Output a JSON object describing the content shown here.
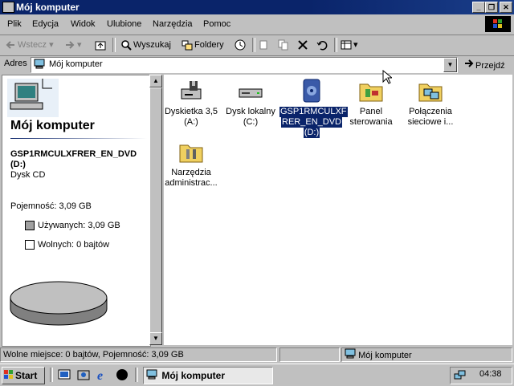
{
  "window": {
    "title": "Mój komputer"
  },
  "menu": [
    "Plik",
    "Edycja",
    "Widok",
    "Ulubione",
    "Narzędzia",
    "Pomoc"
  ],
  "toolbar": {
    "back": "Wstecz",
    "search": "Wyszukaj",
    "folders": "Foldery"
  },
  "address": {
    "label": "Adres",
    "value": "Mój komputer",
    "go": "Przejdź"
  },
  "left_pane": {
    "heading": "Mój komputer",
    "drive_name": "GSP1RMCULXFRER_EN_DVD",
    "drive_letter": "(D:)",
    "drive_type": "Dysk CD",
    "capacity": "Pojemność: 3,09 GB",
    "used": "Używanych: 3,09 GB",
    "free": "Wolnych: 0 bajtów",
    "used_color": "#a0a0a0",
    "free_color": "#ffffff"
  },
  "files": [
    {
      "label1": "Dyskietka 3,5",
      "label2": "(A:)",
      "icon": "floppy-drive-icon"
    },
    {
      "label1": "Dysk lokalny",
      "label2": "(C:)",
      "icon": "hard-drive-icon"
    },
    {
      "label1": "GSP1RMCULXF",
      "label2": "RER_EN_DVD",
      "label3": "(D:)",
      "icon": "cd-drive-icon",
      "selected": true
    },
    {
      "label1": "Panel",
      "label2": "sterowania",
      "icon": "control-panel-icon"
    },
    {
      "label1": "Połączenia",
      "label2": "sieciowe i...",
      "icon": "network-connections-icon"
    },
    {
      "label1": "Narzędzia",
      "label2": "administrac...",
      "icon": "admin-tools-icon"
    }
  ],
  "status": {
    "left": "Wolne miejsce: 0 bajtów, Pojemność: 3,09 GB",
    "right": "Mój komputer"
  },
  "taskbar": {
    "start": "Start",
    "task": "Mój komputer",
    "clock": "04:38"
  },
  "colors": {
    "titlebar": "#0a246a",
    "face": "#c0c0c0",
    "selection": "#0a246a"
  }
}
